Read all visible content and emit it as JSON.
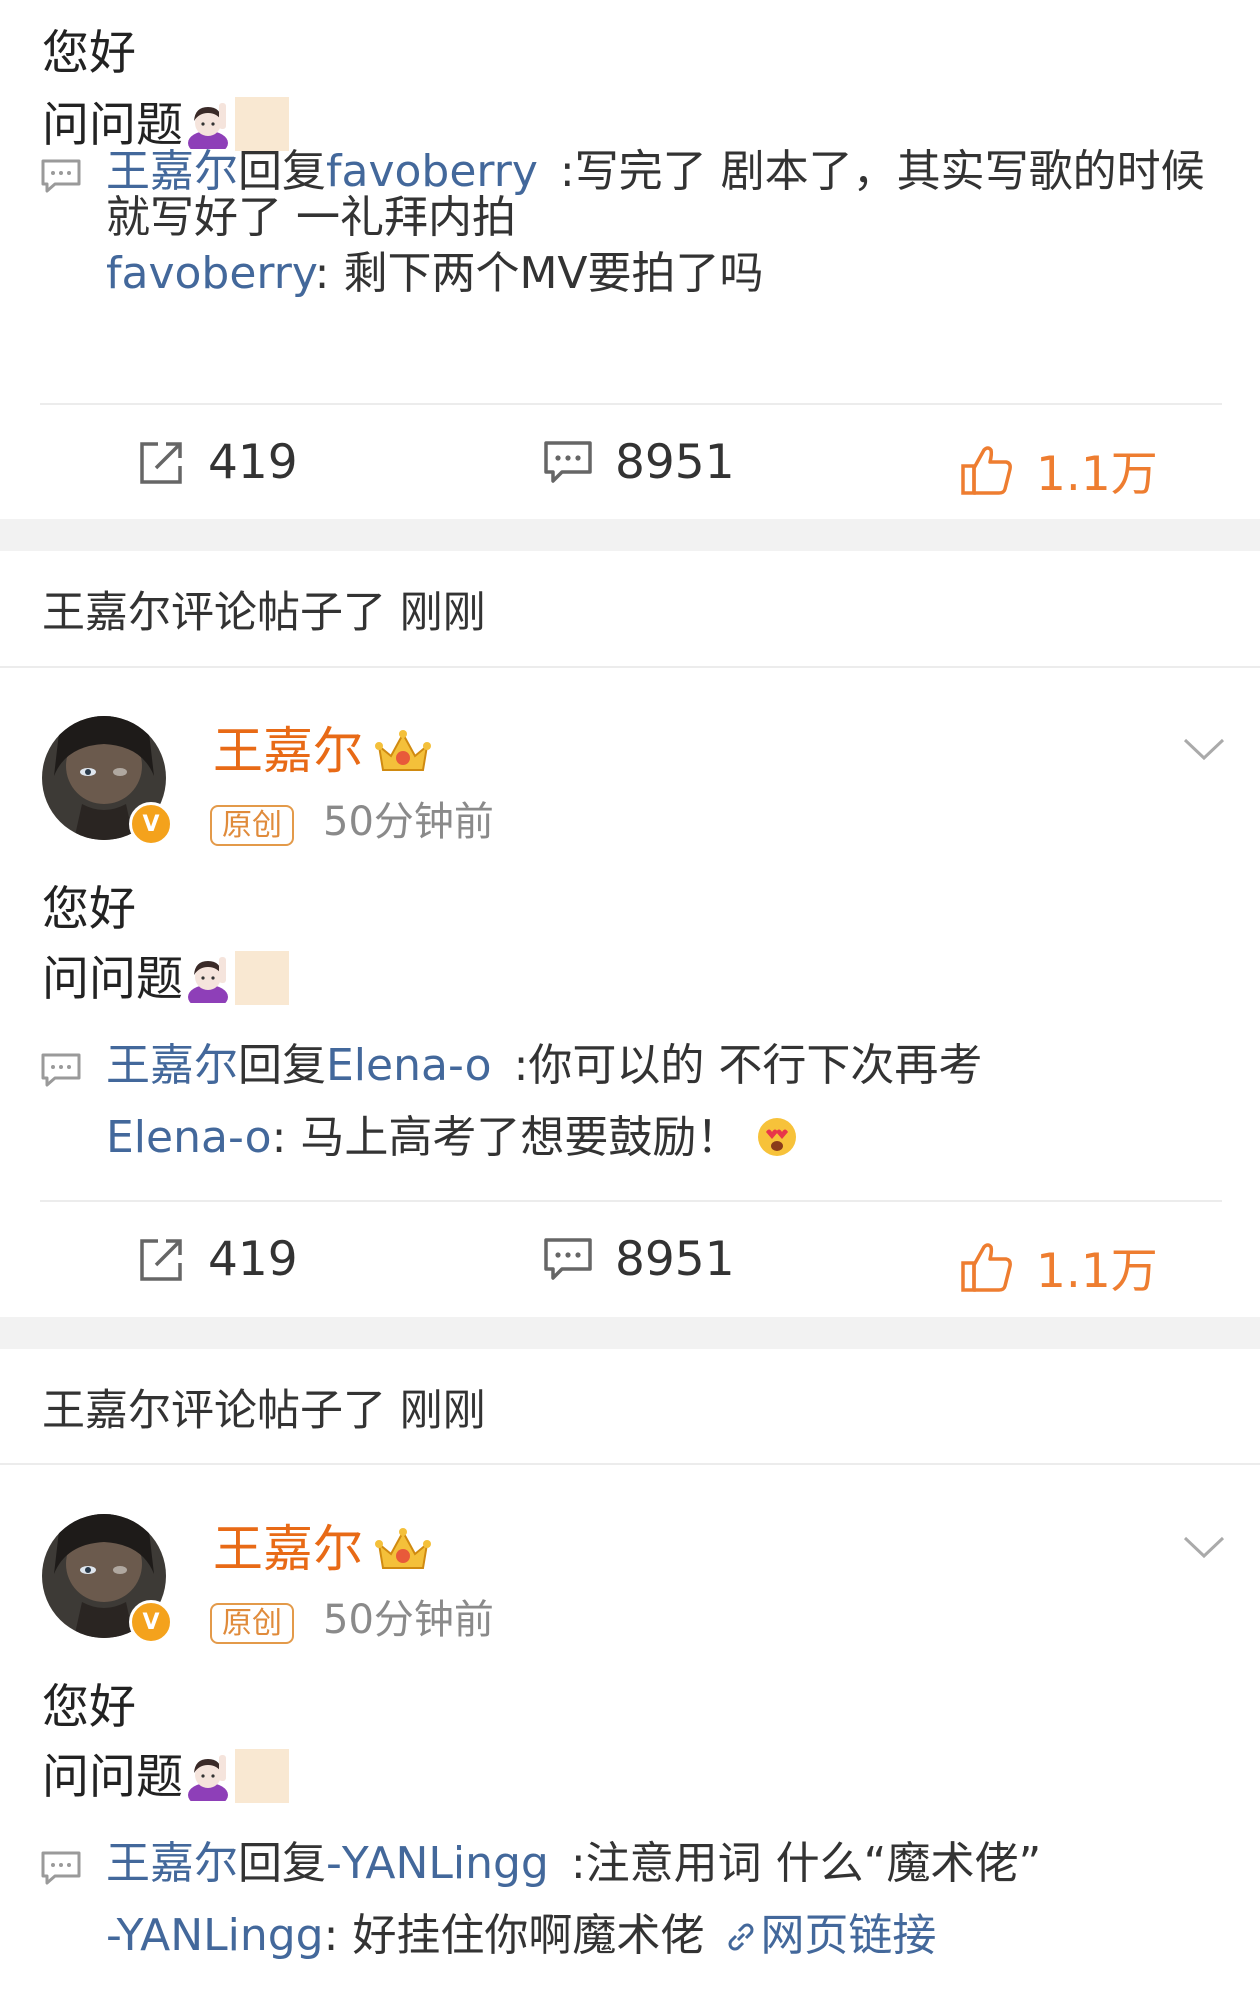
{
  "posts": [
    {
      "text_line1": "您好",
      "text_line2": "问问题",
      "reply": {
        "author": "王嘉尔",
        "reply_word": "回复",
        "target": "favoberry",
        "text_a": ":写完了 剧本了，其实写歌的时候",
        "text_b": "就写好了 一礼拜内拍",
        "quote_author": "favoberry",
        "quote_text": "剩下两个MV要拍了吗"
      },
      "actions": {
        "repost": "419",
        "comment": "8951",
        "like": "1.1万"
      }
    },
    {
      "notice": "王嘉尔评论帖子了 刚刚",
      "name": "王嘉尔",
      "tag": "原创",
      "time": "50分钟前",
      "text_line1": "您好",
      "text_line2": "问问题",
      "reply": {
        "author": "王嘉尔",
        "reply_word": "回复",
        "target": "Elena-o",
        "text_a": ":你可以的 不行下次再考",
        "quote_author": "Elena-o",
        "quote_text": "马上高考了想要鼓励！"
      },
      "actions": {
        "repost": "419",
        "comment": "8951",
        "like": "1.1万"
      }
    },
    {
      "notice": "王嘉尔评论帖子了 刚刚",
      "name": "王嘉尔",
      "tag": "原创",
      "time": "50分钟前",
      "text_line1": "您好",
      "text_line2": "问问题",
      "reply": {
        "author": "王嘉尔",
        "reply_word": "回复",
        "target": "-YANLingg",
        "text_a": ":注意用词 什么“魔术佬”",
        "quote_author": "-YANLingg",
        "quote_text": "好挂住你啊魔术佬",
        "link_label": "网页链接"
      }
    }
  ],
  "badge_letter": "V",
  "icons": {
    "comment": "comment-icon",
    "repost": "repost-icon",
    "like": "thumbs-up-icon",
    "crown": "crown-badge-icon",
    "chevron": "chevron-down-icon",
    "link": "link-icon",
    "emoji_girl": "raising-hand-girl-emoji",
    "emoji_heart_eyes": "heart-eyes-emoji"
  },
  "colors": {
    "link_blue": "#43689b",
    "name_orange": "#e86a16",
    "like_orange": "#ee7d30",
    "badge_gold": "#f4a21c"
  }
}
